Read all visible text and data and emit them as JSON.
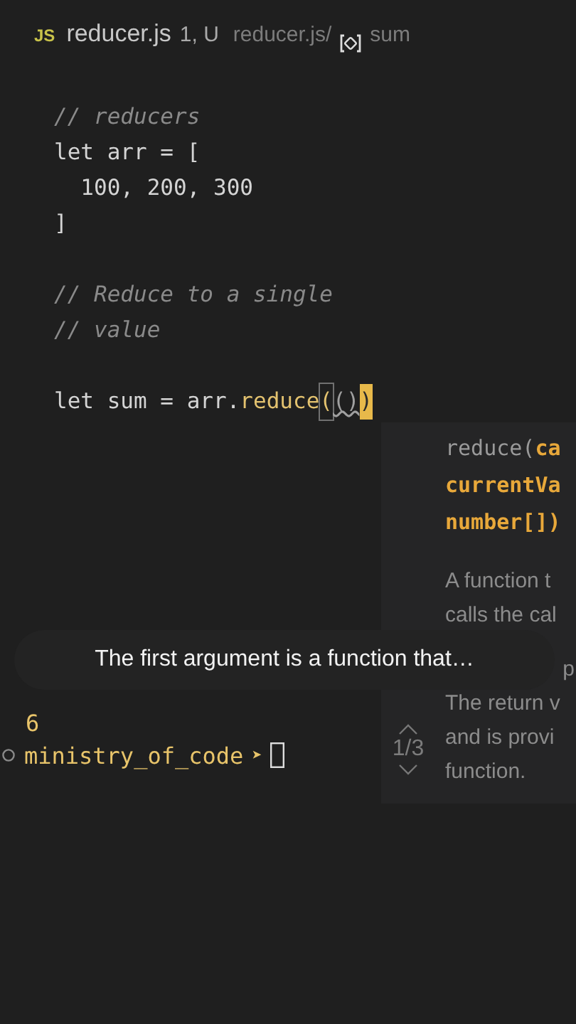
{
  "tab": {
    "badge": "JS",
    "filename": "reducer.js",
    "status": "1, U",
    "breadcrumb_file": "reducer.js/",
    "breadcrumb_symbol": "sum"
  },
  "code": [
    {
      "kind": "code",
      "segments": [
        {
          "text": "// reducers",
          "kind": "comment"
        }
      ]
    },
    {
      "kind": "code",
      "segments": [
        {
          "text": "let arr = [",
          "kind": "plain"
        }
      ]
    },
    {
      "kind": "code",
      "segments": [
        {
          "text": "  100, 200, 300",
          "kind": "plain"
        }
      ]
    },
    {
      "kind": "code",
      "segments": [
        {
          "text": "]",
          "kind": "plain"
        }
      ]
    },
    {
      "kind": "blank"
    },
    {
      "kind": "code",
      "segments": [
        {
          "text": "// Reduce to a single",
          "kind": "comment"
        }
      ]
    },
    {
      "kind": "code",
      "segments": [
        {
          "text": "// value",
          "kind": "comment"
        }
      ]
    },
    {
      "kind": "blank"
    },
    {
      "kind": "code",
      "segments": [
        {
          "text": "let sum = arr.",
          "kind": "plain"
        },
        {
          "text": "reduce",
          "kind": "func"
        },
        {
          "text": "(",
          "kind": "match"
        },
        {
          "text": "()",
          "kind": "squiggle"
        },
        {
          "text": ")",
          "kind": "cursor"
        }
      ]
    }
  ],
  "hover": {
    "signature": [
      [
        {
          "text": "reduce(",
          "kind": "dim"
        },
        {
          "text": "ca",
          "kind": "param"
        }
      ],
      [
        {
          "text": "currentVa",
          "kind": "param"
        }
      ],
      [
        {
          "text": "number[])",
          "kind": "param"
        }
      ]
    ],
    "doc": [
      {
        "text": "A function t",
        "kind": "line"
      },
      {
        "text": "calls the cal",
        "kind": "line"
      },
      {
        "text": "p",
        "kind": "partial"
      },
      {
        "text": "The return v",
        "kind": "line"
      },
      {
        "text": "and is provi",
        "kind": "line"
      },
      {
        "text": "function.",
        "kind": "line"
      }
    ],
    "counter": "1/3"
  },
  "caption": "The first argument is a function that…",
  "terminal": {
    "output": "6",
    "prompt": "ministry_of_code",
    "arrow": "➤"
  }
}
